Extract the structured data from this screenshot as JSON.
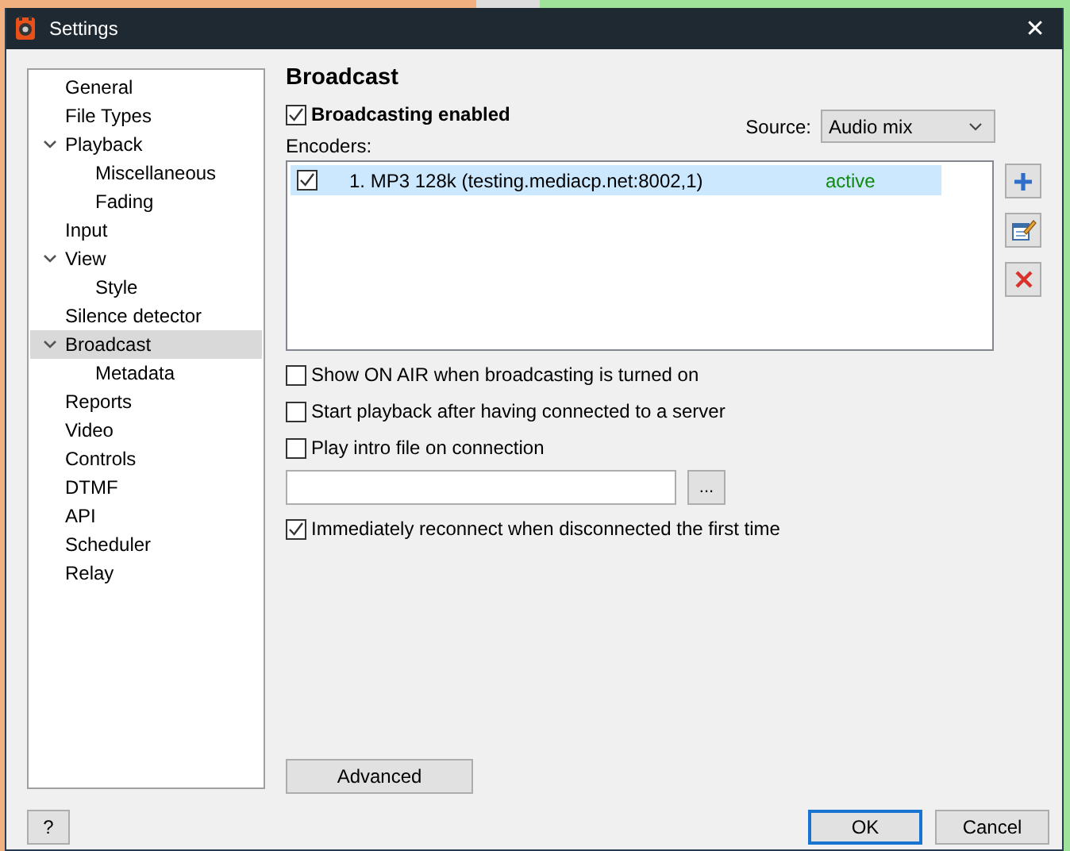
{
  "window": {
    "title": "Settings",
    "close": "✕"
  },
  "tree": [
    {
      "label": "General",
      "selected": false
    },
    {
      "label": "File Types",
      "selected": false
    },
    {
      "label": "Playback",
      "selected": false,
      "expanded": true,
      "children": [
        {
          "label": "Miscellaneous",
          "selected": false
        },
        {
          "label": "Fading",
          "selected": false
        }
      ]
    },
    {
      "label": "Input",
      "selected": false
    },
    {
      "label": "View",
      "selected": false,
      "expanded": true,
      "children": [
        {
          "label": "Style",
          "selected": false
        }
      ]
    },
    {
      "label": "Silence detector",
      "selected": false
    },
    {
      "label": "Broadcast",
      "selected": true,
      "expanded": true,
      "children": [
        {
          "label": "Metadata",
          "selected": false
        }
      ]
    },
    {
      "label": "Reports",
      "selected": false
    },
    {
      "label": "Video",
      "selected": false
    },
    {
      "label": "Controls",
      "selected": false
    },
    {
      "label": "DTMF",
      "selected": false
    },
    {
      "label": "API",
      "selected": false
    },
    {
      "label": "Scheduler",
      "selected": false
    },
    {
      "label": "Relay",
      "selected": false
    }
  ],
  "page": {
    "heading": "Broadcast",
    "broadcasting_enabled": {
      "label": "Broadcasting enabled",
      "checked": true
    },
    "source": {
      "label": "Source:",
      "value": "Audio mix"
    },
    "encoders": {
      "label": "Encoders:",
      "items": [
        {
          "name": "1. MP3 128k (testing.mediacp.net:8002,1)",
          "status": "active",
          "checked": true,
          "selected": true
        }
      ]
    },
    "options": [
      {
        "label": "Show ON AIR when broadcasting is turned on",
        "checked": false
      },
      {
        "label": "Start playback after having connected to a server",
        "checked": false
      },
      {
        "label": "Play intro file on connection",
        "checked": false
      }
    ],
    "intro_file": {
      "browse": "..."
    },
    "reconnect": {
      "label": "Immediately reconnect when disconnected the first time",
      "checked": true
    },
    "advanced": "Advanced"
  },
  "buttons": {
    "help": "?",
    "ok": "OK",
    "cancel": "Cancel"
  }
}
